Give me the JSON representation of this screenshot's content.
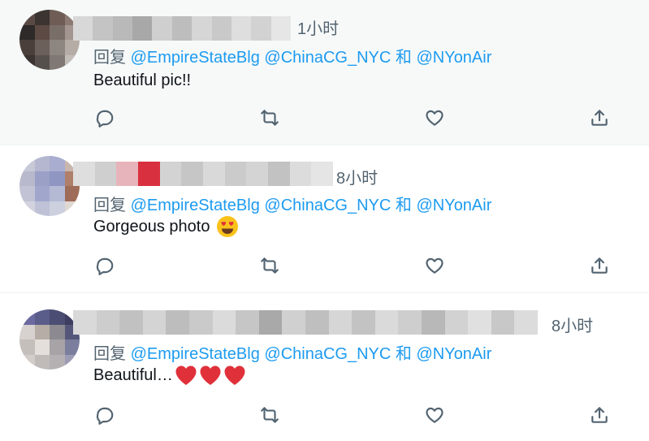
{
  "tweets": [
    {
      "time": "1小时",
      "reply_prefix": "回复",
      "mentions": [
        "@EmpireStateBlg",
        "@ChinaCG_NYC"
      ],
      "conjunction": "和",
      "last_mention": "@NYonAir",
      "text": "Beautiful pic!!"
    },
    {
      "time": "8小时",
      "reply_prefix": "回复",
      "mentions": [
        "@EmpireStateBlg",
        "@ChinaCG_NYC"
      ],
      "conjunction": "和",
      "last_mention": "@NYonAir",
      "text": "Gorgeous photo",
      "emoji": "smiling-face-with-heart-eyes"
    },
    {
      "time": "8小时",
      "reply_prefix": "回复",
      "mentions": [
        "@EmpireStateBlg",
        "@ChinaCG_NYC"
      ],
      "conjunction": "和",
      "last_mention": "@NYonAir",
      "text": "Beautiful…",
      "emoji": "red-heart",
      "emoji_count": 3
    }
  ],
  "actions": [
    "reply-icon",
    "retweet-icon",
    "like-icon",
    "share-icon"
  ],
  "colors": {
    "link": "#1d9bf0",
    "secondary": "#536471",
    "highlight_bg": "#f7f9f9",
    "divider": "#eff3f4",
    "heart": "#e0313b"
  }
}
